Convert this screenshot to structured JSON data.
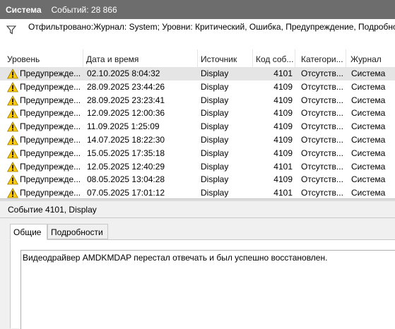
{
  "titlebar": {
    "title": "Система",
    "count_text": "Событий: 28 866"
  },
  "filter": {
    "text": "Отфильтровано:Журнал: System; Уровни: Критический, Ошибка, Предупреждение, Подробно"
  },
  "columns": [
    "Уровень",
    "Дата и время",
    "Источник",
    "Код соб...",
    "Категори...",
    "Журнал"
  ],
  "events": [
    {
      "level": "Предупрежде...",
      "datetime": "02.10.2025 8:04:32",
      "source": "Display",
      "code": "4101",
      "category": "Отсутств...",
      "log": "Система",
      "selected": true
    },
    {
      "level": "Предупрежде...",
      "datetime": "28.09.2025 23:44:26",
      "source": "Display",
      "code": "4109",
      "category": "Отсутств...",
      "log": "Система"
    },
    {
      "level": "Предупрежде...",
      "datetime": "28.09.2025 23:23:41",
      "source": "Display",
      "code": "4109",
      "category": "Отсутств...",
      "log": "Система"
    },
    {
      "level": "Предупрежде...",
      "datetime": "12.09.2025 12:00:36",
      "source": "Display",
      "code": "4109",
      "category": "Отсутств...",
      "log": "Система"
    },
    {
      "level": "Предупрежде...",
      "datetime": "11.09.2025 1:25:09",
      "source": "Display",
      "code": "4109",
      "category": "Отсутств...",
      "log": "Система"
    },
    {
      "level": "Предупрежде...",
      "datetime": "14.07.2025 18:22:30",
      "source": "Display",
      "code": "4109",
      "category": "Отсутств...",
      "log": "Система"
    },
    {
      "level": "Предупрежде...",
      "datetime": "15.05.2025 17:35:18",
      "source": "Display",
      "code": "4109",
      "category": "Отсутств...",
      "log": "Система"
    },
    {
      "level": "Предупрежде...",
      "datetime": "12.05.2025 12:40:29",
      "source": "Display",
      "code": "4101",
      "category": "Отсутств...",
      "log": "Система"
    },
    {
      "level": "Предупрежде...",
      "datetime": "08.05.2025 13:04:28",
      "source": "Display",
      "code": "4109",
      "category": "Отсутств...",
      "log": "Система"
    },
    {
      "level": "Предупрежде...",
      "datetime": "07.05.2025 17:01:12",
      "source": "Display",
      "code": "4101",
      "category": "Отсутств...",
      "log": "Система"
    }
  ],
  "detail": {
    "title": "Событие 4101, Display",
    "tabs": [
      "Общие",
      "Подробности"
    ],
    "active_tab": "Общие",
    "message": "Видеодрайвер AMDKMDAP перестал отвечать и был успешно восстановлен."
  },
  "colors": {
    "titlebar_bg": "#6d6d6d",
    "selected_row": "#e5e5e5",
    "warning_yellow": "#ffcc00"
  },
  "icons": {
    "filter": "funnel-icon",
    "level": "warning-icon"
  }
}
